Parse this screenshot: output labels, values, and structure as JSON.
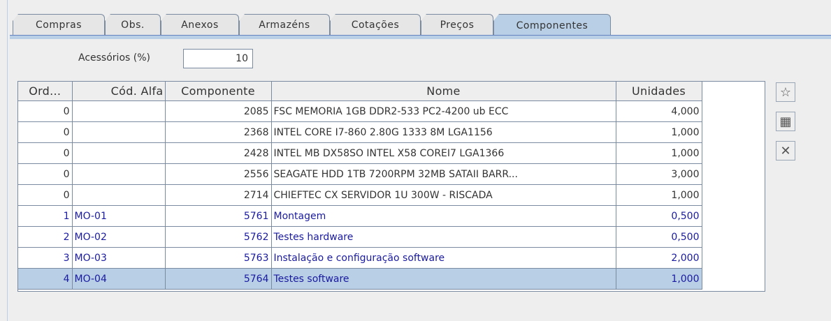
{
  "tabs": [
    {
      "label": "Compras",
      "active": false
    },
    {
      "label": "Obs.",
      "active": false
    },
    {
      "label": "Anexos",
      "active": false
    },
    {
      "label": "Armazéns",
      "active": false
    },
    {
      "label": "Cotações",
      "active": false
    },
    {
      "label": "Preços",
      "active": false
    },
    {
      "label": "Componentes",
      "active": true
    }
  ],
  "accessories": {
    "label": "Acessórios (%)",
    "value": "10"
  },
  "table": {
    "columns": [
      "Ord...",
      "Cód. Alfa",
      "Componente",
      "Nome",
      "Unidades"
    ],
    "rows": [
      {
        "ord": "0",
        "alfa": "",
        "comp": "2085",
        "nome": "FSC MEMORIA 1GB DDR2-533 PC2-4200 ub ECC",
        "un": "4,000"
      },
      {
        "ord": "0",
        "alfa": "",
        "comp": "2368",
        "nome": "INTEL CORE I7-860 2.80G 1333 8M LGA1156",
        "un": "1,000"
      },
      {
        "ord": "0",
        "alfa": "",
        "comp": "2428",
        "nome": "INTEL MB DX58SO INTEL X58 COREI7 LGA1366",
        "un": "1,000"
      },
      {
        "ord": "0",
        "alfa": "",
        "comp": "2556",
        "nome": "SEAGATE HDD 1TB 7200RPM 32MB SATAII BARR...",
        "un": "3,000"
      },
      {
        "ord": "0",
        "alfa": "",
        "comp": "2714",
        "nome": "CHIEFTEC CX SERVIDOR 1U 300W - RISCADA",
        "un": "1,000"
      },
      {
        "ord": "1",
        "alfa": "MO-01",
        "comp": "5761",
        "nome": "Montagem",
        "un": "0,500"
      },
      {
        "ord": "2",
        "alfa": "MO-02",
        "comp": "5762",
        "nome": "Testes hardware",
        "un": "0,500"
      },
      {
        "ord": "3",
        "alfa": "MO-03",
        "comp": "5763",
        "nome": "Instalação e configuração software",
        "un": "2,000"
      },
      {
        "ord": "4",
        "alfa": "MO-04",
        "comp": "5764",
        "nome": "Testes software",
        "un": "1,000"
      }
    ]
  },
  "side_buttons": [
    {
      "icon": "star-icon",
      "glyph": "☆"
    },
    {
      "icon": "keyboard-icon",
      "glyph": "▦"
    },
    {
      "icon": "delete-icon",
      "glyph": "✕"
    }
  ],
  "colors": {
    "tab_active": "#b8cfe5",
    "row_selected": "#b8cfe5",
    "service_text": "#1a1aa0"
  }
}
